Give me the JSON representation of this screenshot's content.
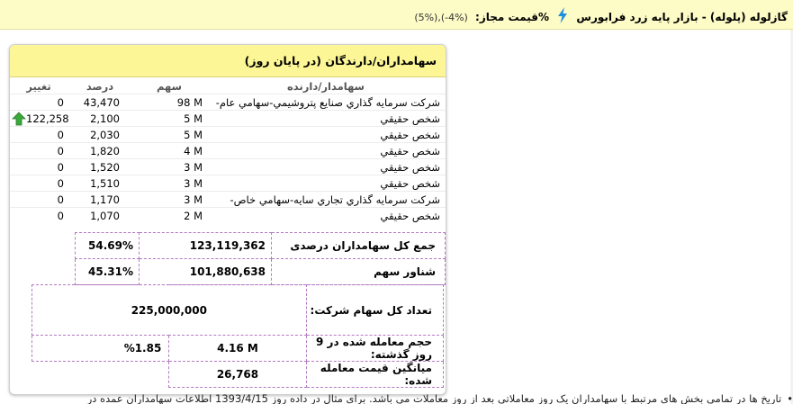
{
  "header": {
    "title": "گازلوله (پلوله) - بازار پایه زرد فرابورس",
    "limit_label": "%قیمت مجاز:",
    "limit_value": "(5%),(-4%)"
  },
  "colors": {
    "topbar_bg": "#fdfbc6",
    "panel_header_bg": "#fcf696",
    "up_arrow": "#3aa93a",
    "dashed_border": "#b37ac2"
  },
  "panel": {
    "title": "سهامداران/دارندگان (در پایان روز)",
    "columns": {
      "holder": "سهامدار/دارنده",
      "shares": "سهم",
      "percent": "درصد",
      "change": "تغییر"
    },
    "rows": [
      {
        "holder": "شركت سرمايه گذاري صنايع پتروشيمي-سهامي عام-",
        "shares": "98 M",
        "percent": "43,470",
        "change": "0",
        "arrow": false
      },
      {
        "holder": "شخص حقيقي",
        "shares": "5 M",
        "percent": "2,100",
        "change": "122,258",
        "arrow": true
      },
      {
        "holder": "شخص حقيقي",
        "shares": "5 M",
        "percent": "2,030",
        "change": "0",
        "arrow": false
      },
      {
        "holder": "شخص حقيقي",
        "shares": "4 M",
        "percent": "1,820",
        "change": "0",
        "arrow": false
      },
      {
        "holder": "شخص حقيقي",
        "shares": "3 M",
        "percent": "1,520",
        "change": "0",
        "arrow": false
      },
      {
        "holder": "شخص حقيقي",
        "shares": "3 M",
        "percent": "1,510",
        "change": "0",
        "arrow": false
      },
      {
        "holder": "شركت سرمايه گذاري تجاري سايه-سهامي خاص-",
        "shares": "3 M",
        "percent": "1,170",
        "change": "0",
        "arrow": false
      },
      {
        "holder": "شخص حقيقي",
        "shares": "2 M",
        "percent": "1,070",
        "change": "0",
        "arrow": false
      }
    ],
    "summary": {
      "total_label": "جمع کل سهامداران درصدی",
      "total_value": "123,119,362",
      "total_pct": "54.69%",
      "float_label": "شناور سهم",
      "float_value": "101,880,638",
      "float_pct": "45.31%"
    },
    "stats": {
      "company_shares_label": "تعداد کل سهام شرکت:",
      "company_shares_value": "225,000,000",
      "volume_label": "حجم معامله شده در 9 روز گذشته:",
      "volume_value": "4.16 M",
      "volume_pct": "%1.85",
      "avg_price_label": "میانگین قیمت معامله شده:",
      "avg_price_value": "26,768"
    }
  },
  "footer_note": "تاریخ ها در تمامی بخش های مرتبط با سهامداران یک روز معاملاتی بعد از روز معاملات می باشد. برای مثال در داده روز 1393/4/15 اطلاعات سهامداران عمده در"
}
